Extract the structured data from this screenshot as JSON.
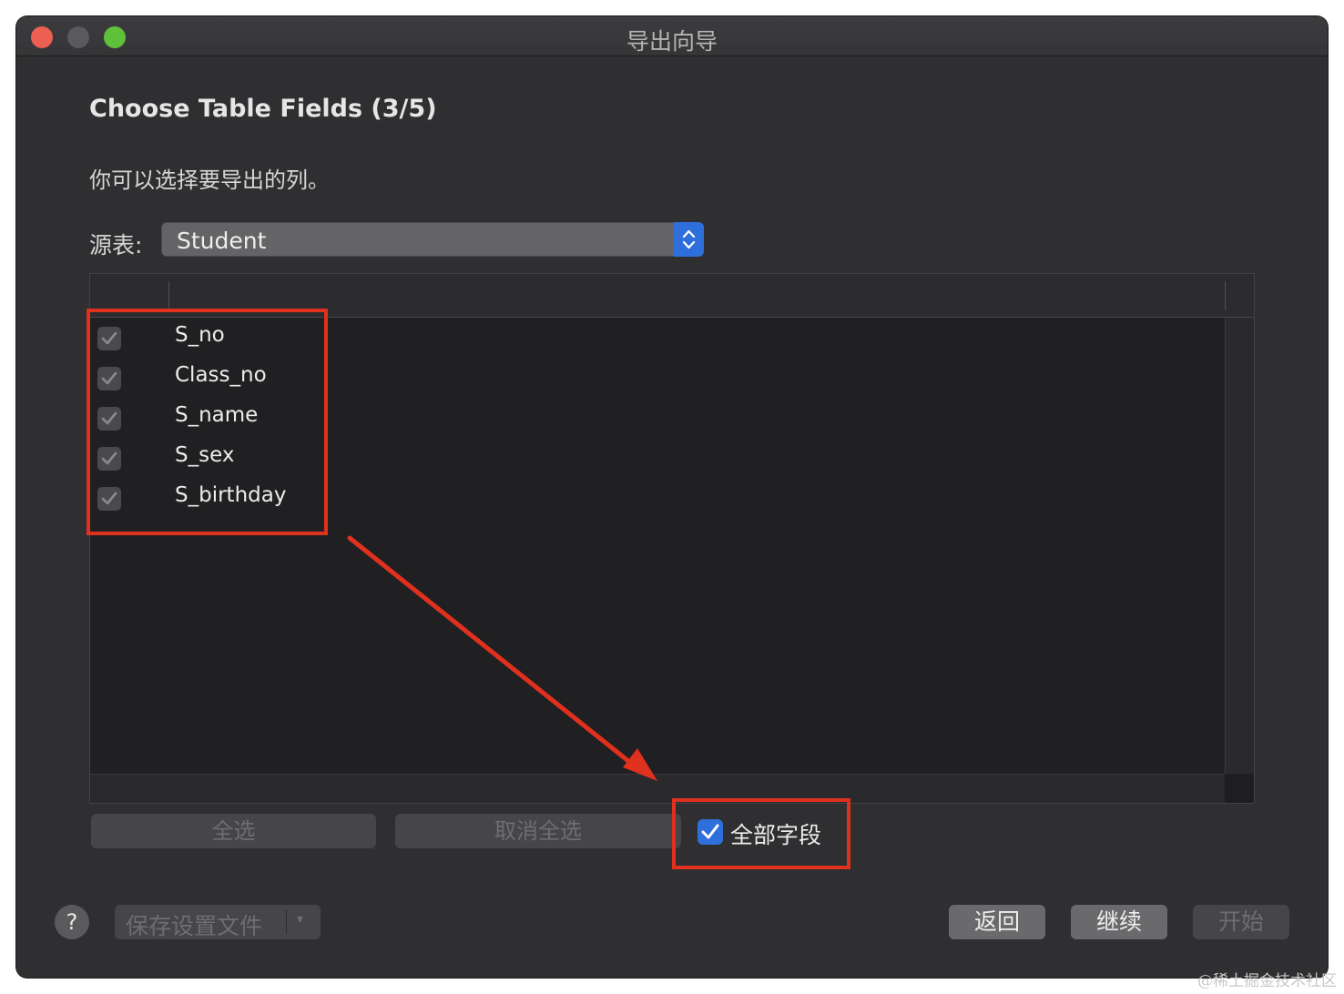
{
  "window": {
    "title": "导出向导"
  },
  "wizard": {
    "heading": "Choose Table Fields (3/5)",
    "subtitle": "你可以选择要导出的列。",
    "source_label": "源表:",
    "source_value": "Student"
  },
  "fields": [
    {
      "name": "S_no",
      "checked": true
    },
    {
      "name": "Class_no",
      "checked": true
    },
    {
      "name": "S_name",
      "checked": true
    },
    {
      "name": "S_sex",
      "checked": true
    },
    {
      "name": "S_birthday",
      "checked": true
    }
  ],
  "actions": {
    "select_all": "全选",
    "deselect_all": "取消全选",
    "all_fields_label": "全部字段",
    "all_fields_checked": true
  },
  "footer": {
    "help": "?",
    "save_profile": "保存设置文件",
    "save_dropdown_arrow": "▾",
    "back": "返回",
    "continue": "继续",
    "start": "开始"
  },
  "colors": {
    "accent": "#2f6fdb",
    "annotation": "#e0301e"
  },
  "watermark": "@稀土掘金技术社区"
}
